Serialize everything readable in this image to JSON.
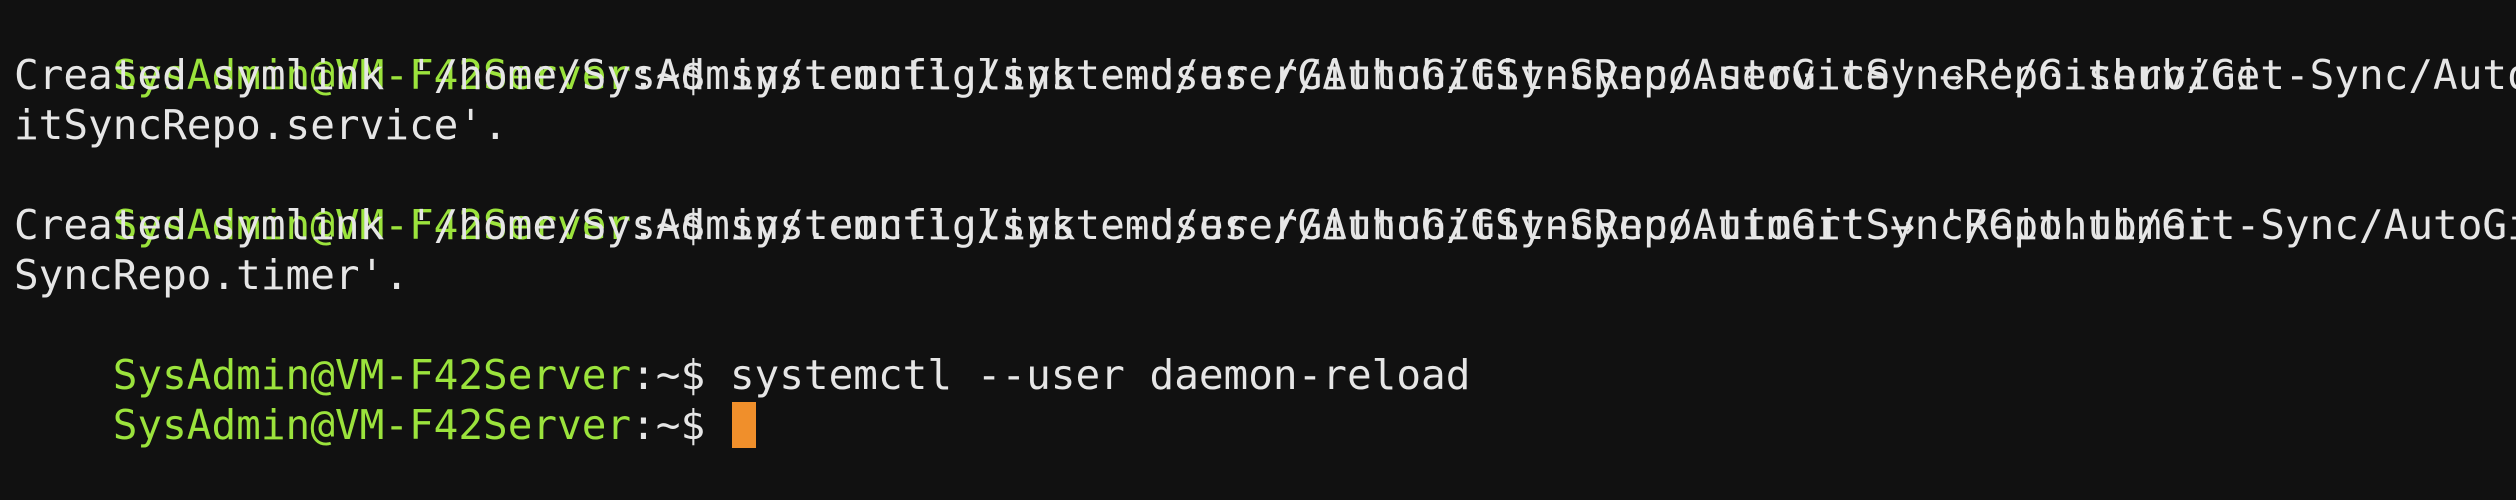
{
  "terminal": {
    "prompt": {
      "user_host": "SysAdmin@VM-F42Server",
      "path_suffix": ":~$ "
    },
    "lines": [
      {
        "type": "command",
        "text": "systemctl link --user /Github/Git-Sync/AutoGitSyncRepo.service"
      },
      {
        "type": "output",
        "text": "Created symlink '/home/SysAdmin/.config/systemd/user/AutoGitSyncRepo.service' → '/Github/Git-Sync/AutoG"
      },
      {
        "type": "output",
        "text": "itSyncRepo.service'."
      },
      {
        "type": "command",
        "text": "systemctl link --user /Github/Git-Sync/AutoGitSyncRepo.timer"
      },
      {
        "type": "output",
        "text": "Created symlink '/home/SysAdmin/.config/systemd/user/AutoGitSyncRepo.timer' → '/Github/Git-Sync/AutoGit"
      },
      {
        "type": "output",
        "text": "SyncRepo.timer'."
      },
      {
        "type": "command",
        "text": "systemctl --user daemon-reload"
      },
      {
        "type": "input",
        "text": ""
      }
    ],
    "colors": {
      "background": "#111111",
      "prompt_user": "#9be33c",
      "text": "#e6e6e6",
      "cursor": "#f08f2b"
    }
  }
}
